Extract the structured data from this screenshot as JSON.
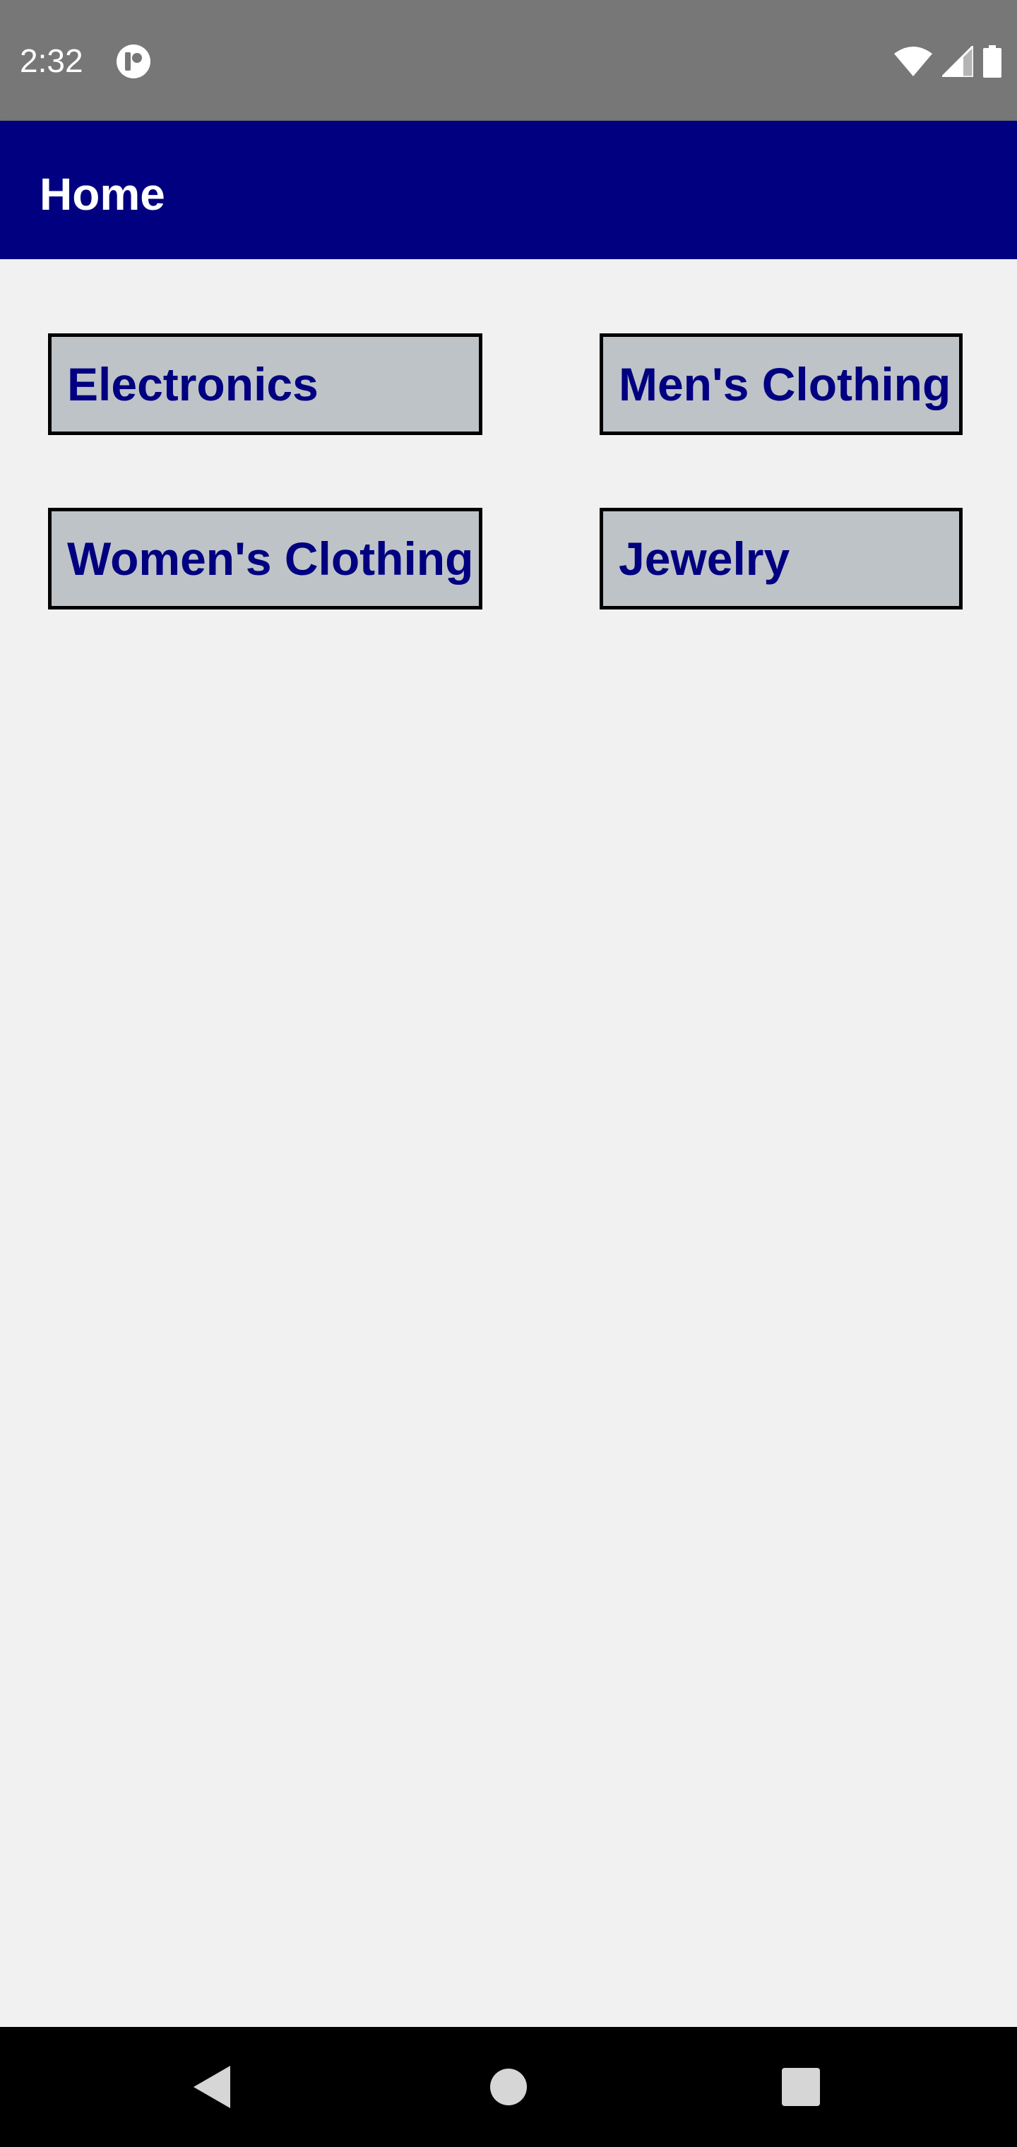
{
  "status_bar": {
    "time": "2:32",
    "icons": [
      "app-notification-icon",
      "wifi-icon",
      "cell-signal-icon",
      "battery-icon"
    ]
  },
  "app_bar": {
    "title": "Home",
    "color": "#000080"
  },
  "categories": [
    {
      "label": "Electronics"
    },
    {
      "label": "Men's Clothing"
    },
    {
      "label": "Women's Clothing"
    },
    {
      "label": "Jewelry"
    }
  ],
  "nav_bar": {
    "icons": [
      "back-icon",
      "home-icon",
      "recents-icon"
    ]
  },
  "colors": {
    "status_bar": "#777777",
    "button_bg": "#bec3c8",
    "button_text": "#000080",
    "background": "#f1f1f1"
  }
}
